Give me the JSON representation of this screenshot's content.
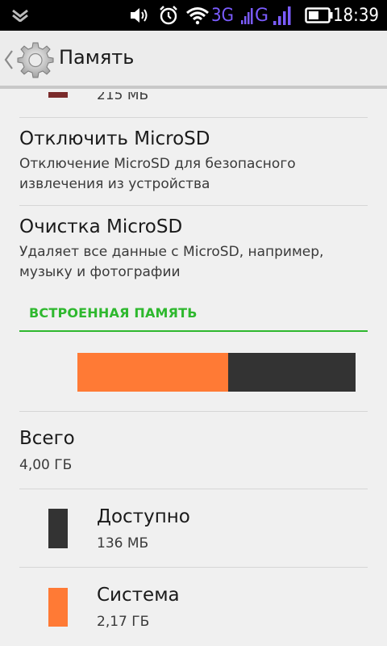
{
  "status_bar": {
    "network_3g": "3G",
    "network_g": "G",
    "time": "18:39"
  },
  "action_bar": {
    "title": "Память",
    "icon": "settings-gear-icon"
  },
  "external": {
    "partial_item_value": "215 МБ",
    "partial_item_color": "#7a2b2b",
    "unmount": {
      "title": "Отключить MicroSD",
      "summary_line1": "Отключение MicroSD для безопасного",
      "summary_line2": "извлечения из устройства"
    },
    "erase": {
      "title": "Очистка MicroSD",
      "summary_line1": "Удаляет все данные с MicroSD, например,",
      "summary_line2": "музыку и фотографии"
    }
  },
  "internal": {
    "header": "ВСТРОЕННАЯ ПАМЯТЬ",
    "usage_bar": [
      {
        "name": "Система",
        "color": "#ff7a35",
        "fraction": 0.543
      },
      {
        "name": "Доступно",
        "color": "#333333",
        "fraction": 0.457
      }
    ],
    "total": {
      "title": "Всего",
      "value": "4,00 ГБ"
    },
    "items": [
      {
        "title": "Доступно",
        "value": "136 МБ",
        "color": "#333333"
      },
      {
        "title": "Система",
        "value": "2,17 ГБ",
        "color": "#ff7a35"
      }
    ]
  },
  "colors": {
    "accent": "#2eb82e",
    "status_bar_bg": "#000000",
    "network_color": "#7b5cff"
  }
}
